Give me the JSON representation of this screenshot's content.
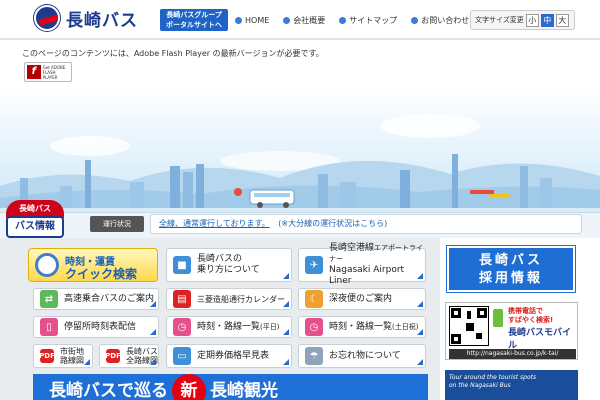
{
  "header": {
    "logo_text": "長崎バス",
    "portal_btn_line1": "長崎バスグループ",
    "portal_btn_line2": "ポータルサイトへ",
    "nav": [
      "HOME",
      "会社概要",
      "サイトマップ",
      "お問い合わせ"
    ],
    "fontsize_label": "文字サイズ変更",
    "fontsize_options": [
      "小",
      "中",
      "大"
    ],
    "fontsize_selected": "中"
  },
  "flash": {
    "message": "このページのコンテンツには、Adobe Flash Player の最新バージョンが必要です。",
    "badge_line1": "Get ADOBE",
    "badge_line2": "FLASH PLAYER"
  },
  "bus_info": {
    "top": "長崎バス",
    "bottom": "バス情報"
  },
  "news": {
    "label": "運行状況",
    "status_link": "全線、通常運行しております。",
    "note": "(※大分線の運行状況はこちら)"
  },
  "quick": {
    "line1": "時刻・運賃",
    "line2": "クイック検索"
  },
  "tiles": {
    "norikata_1": "長崎バスの",
    "norikata_2": "乗り方について",
    "airport_1": "長崎空港線",
    "airport_1b": "エアポートライナー",
    "airport_2": "Nagasaki Airport Liner",
    "highway": "高速乗合バスのご案内",
    "mitsubishi": "三菱造船通行カレンダー",
    "latenight": "深夜便のご案内",
    "stop_tt": "停留所時刻表配信",
    "tt_weekday": "時刻・路線一覧",
    "tt_weekday_small": "(平日)",
    "tt_weekend": "時刻・路線一覧",
    "tt_weekend_small": "(土日祝)",
    "map1_1": "市街地",
    "map1_2": "路線図",
    "map2_1": "長崎バス",
    "map2_2": "全路線図",
    "pass": "定期券価格早見表",
    "lost": "お忘れ物について"
  },
  "right": {
    "recruit_1": "長崎バス",
    "recruit_2": "採用情報",
    "mobile_1": "携帯電話で",
    "mobile_2": "すばやく検索!",
    "mobile_3": "長崎バスモバイル",
    "mobile_url": "http://nagasaki-bus.co.jp/k-tai/",
    "tour_1": "Tour around the tourist spots",
    "tour_2": "on the Nagasaki Bus"
  },
  "banner": {
    "pre": "長崎バスで巡る",
    "new": "新",
    "post": "長崎観光"
  },
  "colors": {
    "brand_blue": "#1d3c8f",
    "accent_blue": "#1f6ed4",
    "brand_red": "#e60012",
    "quick_yellow": "#ffd84a"
  }
}
